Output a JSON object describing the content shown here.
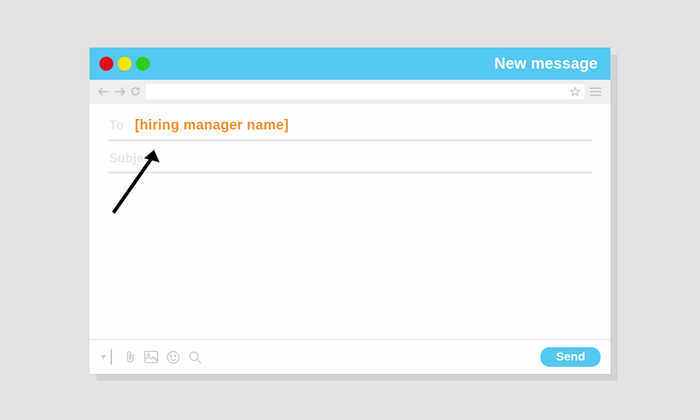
{
  "window": {
    "title": "New message"
  },
  "compose": {
    "to_label": "To",
    "to_value": "[hiring manager name]",
    "subject_label": "Subject",
    "subject_value": ""
  },
  "footer": {
    "send_label": "Send"
  }
}
